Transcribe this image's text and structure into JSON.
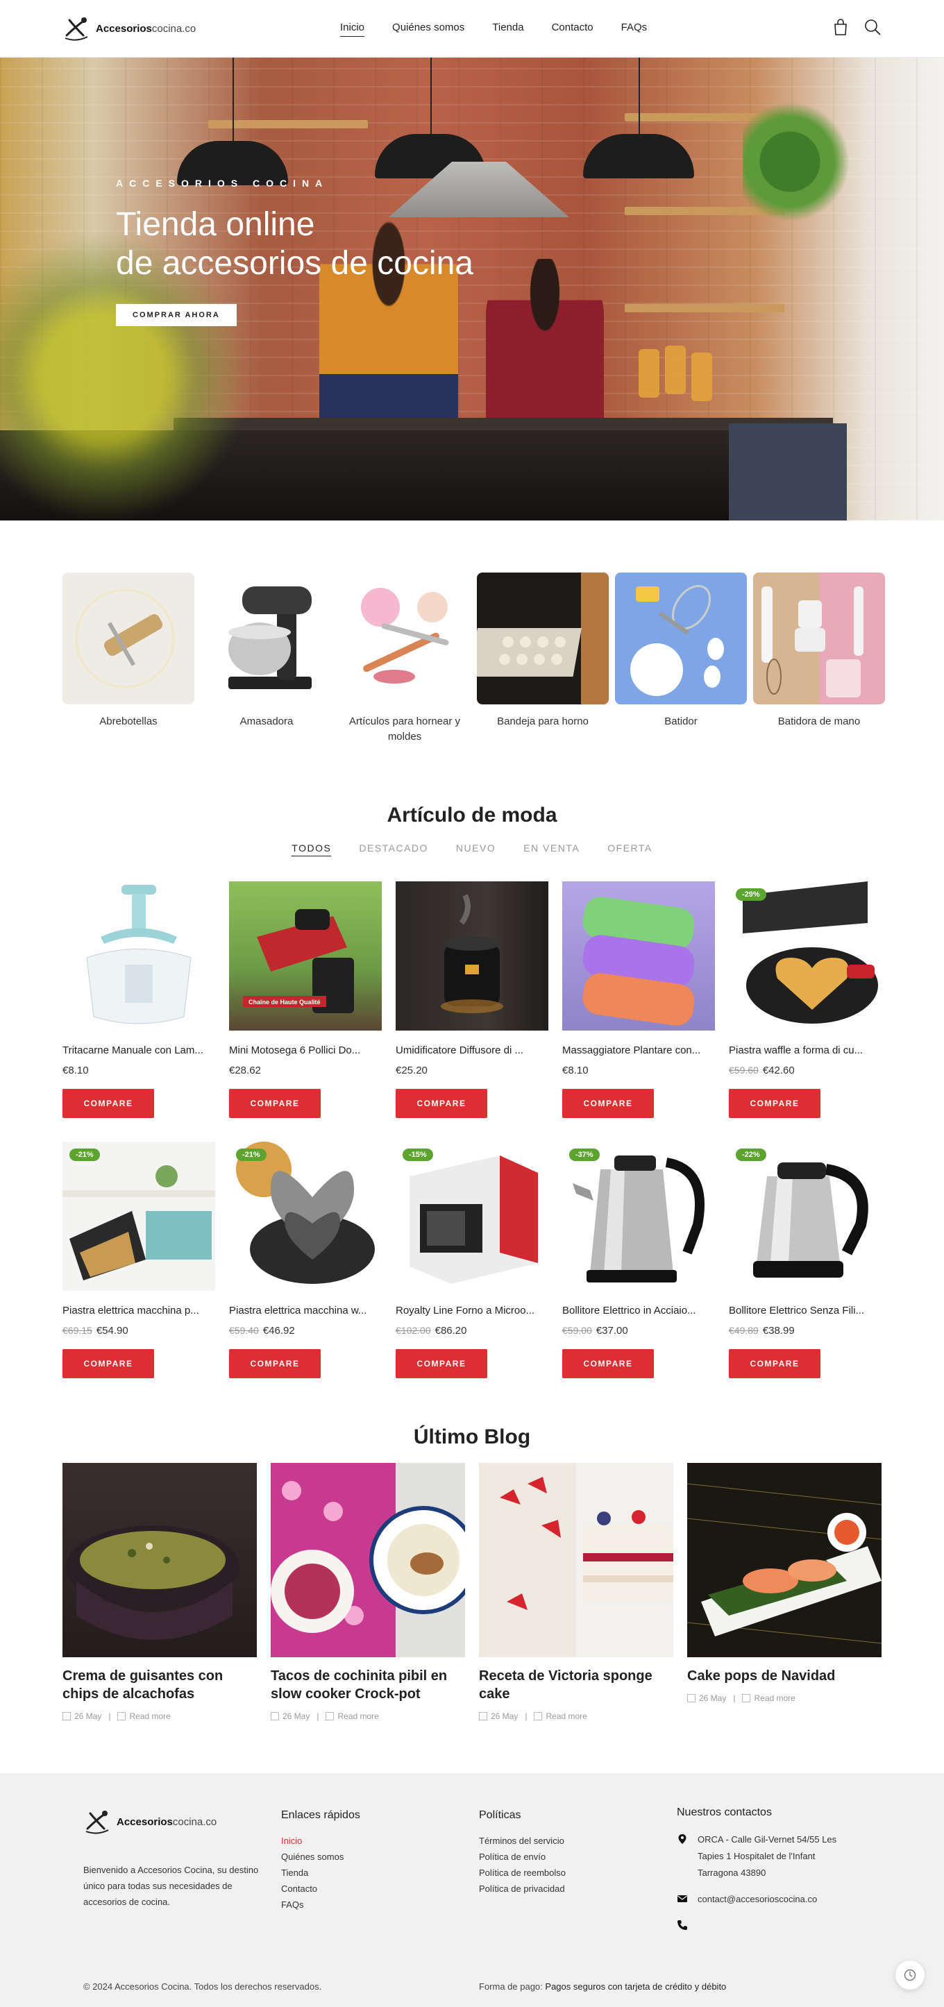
{
  "header": {
    "logo_bold": "Accesorios",
    "logo_light": "cocina.co",
    "nav": [
      {
        "label": "Inicio"
      },
      {
        "label": "Quiénes somos"
      },
      {
        "label": "Tienda"
      },
      {
        "label": "Contacto"
      },
      {
        "label": "FAQs"
      }
    ],
    "active_nav": "Inicio",
    "icons": [
      "bag-icon",
      "search-icon"
    ]
  },
  "hero": {
    "eyebrow": "ACCESORIOS COCINA",
    "title_line1": "Tienda online",
    "title_line2": "de accesorios de cocina",
    "button": "COMPRAR AHORA"
  },
  "categories": [
    {
      "label": "Abrebotellas"
    },
    {
      "label": "Amasadora"
    },
    {
      "label": "Artículos para hornear y moldes"
    },
    {
      "label": "Bandeja para horno"
    },
    {
      "label": "Batidor"
    },
    {
      "label": "Batidora de mano"
    }
  ],
  "trending": {
    "title": "Artículo de moda",
    "tabs": [
      "TODOS",
      "DESTACADO",
      "NUEVO",
      "EN VENTA",
      "OFERTA"
    ],
    "active_tab": "TODOS",
    "compare_label": "COMPARE",
    "products": [
      {
        "name": "Tritacarne Manuale con Lam...",
        "price": "€8.10",
        "old_price": "",
        "badge": ""
      },
      {
        "name": "Mini Motosega 6 Pollici Do...",
        "price": "€28.62",
        "old_price": "",
        "badge": ""
      },
      {
        "name": "Umidificatore Diffusore di ...",
        "price": "€25.20",
        "old_price": "",
        "badge": ""
      },
      {
        "name": "Massaggiatore Plantare con...",
        "price": "€8.10",
        "old_price": "",
        "badge": ""
      },
      {
        "name": "Piastra waffle a forma di cu...",
        "price": "€42.60",
        "old_price": "€59.60",
        "badge": "-29%"
      },
      {
        "name": "Piastra elettrica macchina p...",
        "price": "€54.90",
        "old_price": "€69.15",
        "badge": "-21%"
      },
      {
        "name": "Piastra elettrica macchina w...",
        "price": "€46.92",
        "old_price": "€59.40",
        "badge": "-21%"
      },
      {
        "name": "Royalty Line Forno a Microo...",
        "price": "€86.20",
        "old_price": "€102.00",
        "badge": "-15%"
      },
      {
        "name": "Bollitore Elettrico in Acciaio...",
        "price": "€37.00",
        "old_price": "€59.00",
        "badge": "-37%"
      },
      {
        "name": "Bollitore Elettrico Senza Fili...",
        "price": "€38.99",
        "old_price": "€49.89",
        "badge": "-22%"
      }
    ],
    "product_image_text": "Chaîne de Haute Qualité"
  },
  "blog": {
    "title": "Último Blog",
    "read_more": "Read more",
    "posts": [
      {
        "title": "Crema de guisantes con chips de alcachofas",
        "date": "26 May"
      },
      {
        "title": "Tacos de cochinita pibil en slow cooker Crock-pot",
        "date": "26 May"
      },
      {
        "title": "Receta de Victoria sponge cake",
        "date": "26 May"
      },
      {
        "title": "Cake pops de Navidad",
        "date": "26 May"
      }
    ]
  },
  "footer": {
    "about": "Bienvenido a Accesorios Cocina, su destino único para todas sus necesidades de accesorios de cocina.",
    "quick_links_title": "Enlaces rápidos",
    "quick_links": [
      "Inicio",
      "Quiénes somos",
      "Tienda",
      "Contacto",
      "FAQs"
    ],
    "policies_title": "Políticas",
    "policies": [
      "Términos del servicio",
      "Política de envío",
      "Política de reembolso",
      "Política de privacidad"
    ],
    "contact_title": "Nuestros contactos",
    "address": "ORCA - Calle Gil-Vernet 54/55 Les Tapies 1 Hospitalet de l'Infant Tarragona 43890",
    "email": "contact@accesorioscocina.co",
    "phone": "",
    "copyright": "© 2024 Accesorios Cocina. Todos los derechos reservados.",
    "payment_label": "Forma de pago:",
    "payment_value": "Pagos seguros con tarjeta de crédito y débito"
  },
  "colors": {
    "accent_red": "#dd2e33",
    "badge_green": "#5ba52f",
    "footer_bg": "#f1f1f1"
  }
}
